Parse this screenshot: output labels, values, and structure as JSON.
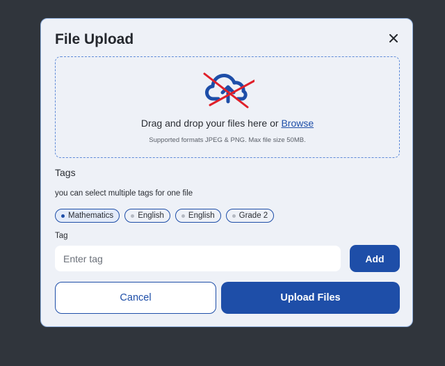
{
  "modal": {
    "title": "File Upload",
    "close_icon": "close-icon"
  },
  "dropzone": {
    "icon": "cloud-upload-icon",
    "drag_text": "Drag and drop your files here or",
    "browse_label": "Browse",
    "formats_text": "Supported formats JPEG & PNG. Max file size 50MB."
  },
  "tags": {
    "heading": "Tags",
    "hint": "you can select multiple tags for one file",
    "items": [
      {
        "label": "Mathematics",
        "selected": true
      },
      {
        "label": "English",
        "selected": false
      },
      {
        "label": "English",
        "selected": false
      },
      {
        "label": "Grade 2",
        "selected": false
      }
    ]
  },
  "tag_input": {
    "label": "Tag",
    "placeholder": "Enter tag",
    "value": "",
    "add_label": "Add"
  },
  "footer": {
    "cancel_label": "Cancel",
    "upload_label": "Upload Files"
  },
  "colors": {
    "background": "#30353c",
    "modal_bg": "#eef1f7",
    "accent": "#1e4ea8",
    "strike": "#e0202a"
  }
}
